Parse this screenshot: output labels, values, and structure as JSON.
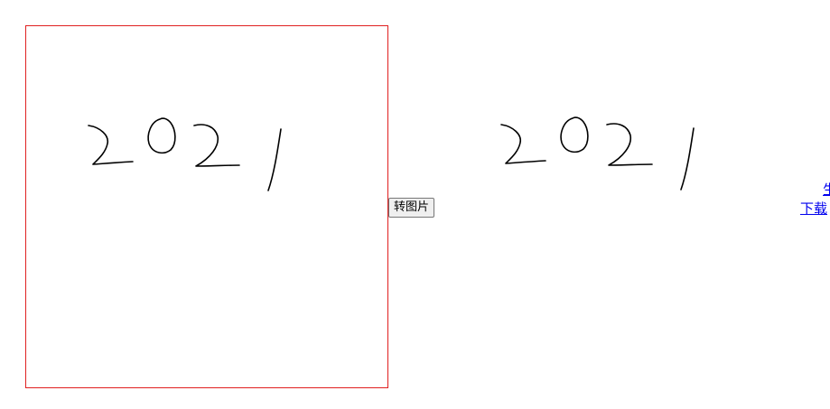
{
  "toolbar": {
    "convert_label": "转图片"
  },
  "links": {
    "download_label": "下载",
    "clipped_label": "生"
  },
  "canvas": {
    "border_color": "#e02020",
    "stroke_color": "#000000"
  }
}
